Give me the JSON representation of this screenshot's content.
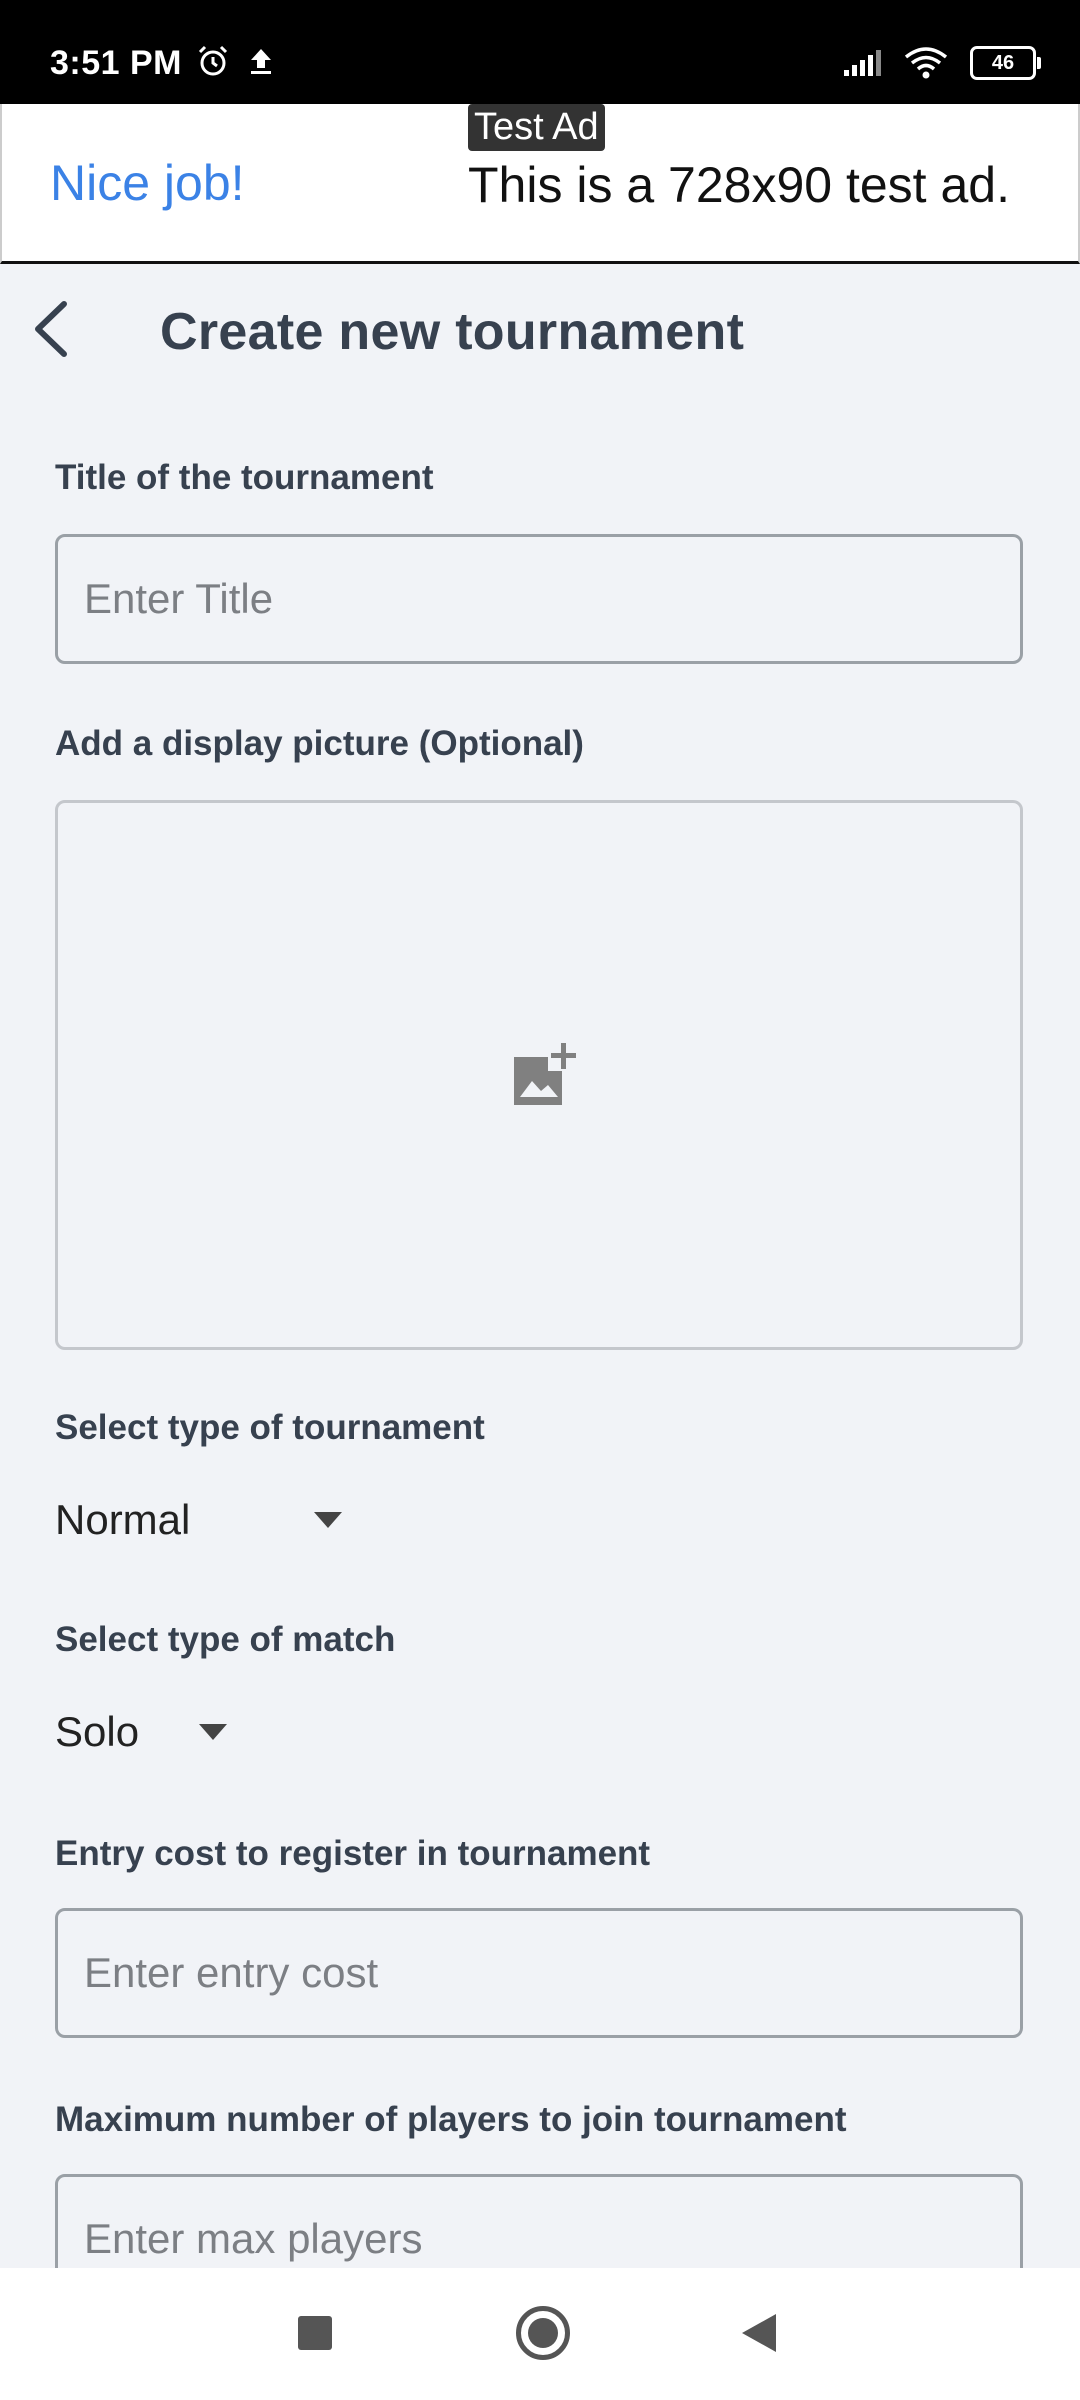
{
  "status_bar": {
    "time": "3:51 PM",
    "battery": "46",
    "icons": [
      "alarm-icon",
      "upload-icon",
      "signal-icon",
      "wifi-icon",
      "battery-icon"
    ]
  },
  "ad": {
    "headline": "Nice job!",
    "tag": "Test Ad",
    "text": "This is a 728x90 test ad."
  },
  "header": {
    "title": "Create new tournament"
  },
  "form": {
    "title_label": "Title of the tournament",
    "title_placeholder": "Enter Title",
    "picture_label": "Add a display picture (Optional)",
    "tournament_type_label": "Select type of tournament",
    "tournament_type_value": "Normal",
    "match_type_label": "Select type of match",
    "match_type_value": "Solo",
    "entry_cost_label": "Entry cost to register in tournament",
    "entry_cost_placeholder": "Enter entry cost",
    "max_players_label": "Maximum number of players to join tournament",
    "max_players_placeholder": "Enter max players"
  },
  "colors": {
    "background": "#f1f3f7",
    "ad_headline": "#3b82e6",
    "heading": "#37414f"
  }
}
